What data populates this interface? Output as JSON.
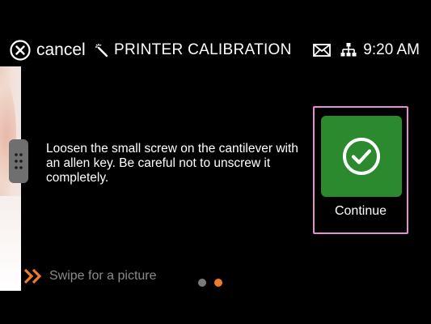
{
  "header": {
    "cancel_label": "cancel",
    "cancel_icon": "close-circle-icon",
    "title_icon": "magic-wand-icon",
    "title": "PRINTER CALIBRATION",
    "status_icons": [
      "mail-icon",
      "network-icon"
    ],
    "time": "9:20 AM"
  },
  "main": {
    "instruction": "Loosen the small screw on the cantilever with an allen key. Be careful not to unscrew it completely.",
    "continue": {
      "label": "Continue",
      "icon": "check-circle-icon",
      "tile_color": "#2c8a2e",
      "highlight_color": "#e58fd2"
    }
  },
  "footer": {
    "swipe_icon": "double-chevron-right-icon",
    "swipe_label": "Swipe for a picture",
    "pager": {
      "pages": 2,
      "active_index": 1,
      "active_color": "#f07a2a",
      "inactive_color": "#7a7a7a"
    }
  },
  "colors": {
    "accent": "#f07a2a",
    "background": "#000000",
    "text": "#ffffff",
    "muted_text": "#8a8a8a"
  }
}
